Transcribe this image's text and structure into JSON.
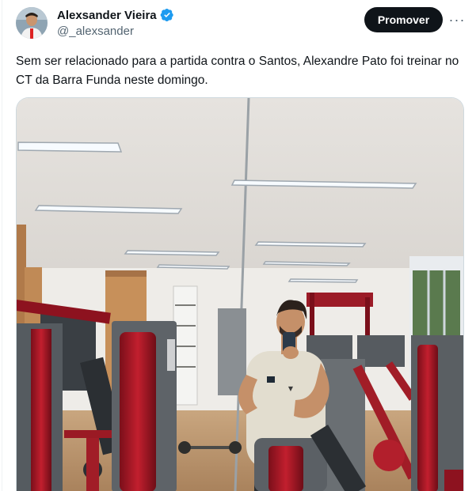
{
  "author": {
    "display_name": "Alexsander Vieira",
    "handle": "@_alexsander",
    "verified": true,
    "verified_icon": "verified-badge-icon",
    "verified_color": "#1d9bf0"
  },
  "actions": {
    "promote_label": "Promover",
    "more_icon": "more-horizontal-icon",
    "more_glyph": "···"
  },
  "tweet": {
    "text": "Sem ser relacionado para a partida contra o Santos, Alexandre Pato foi treinar no CT da Barra Funda neste domingo."
  },
  "colors": {
    "text_primary": "#0f1419",
    "text_secondary": "#536471",
    "button_bg": "#0f1419"
  }
}
